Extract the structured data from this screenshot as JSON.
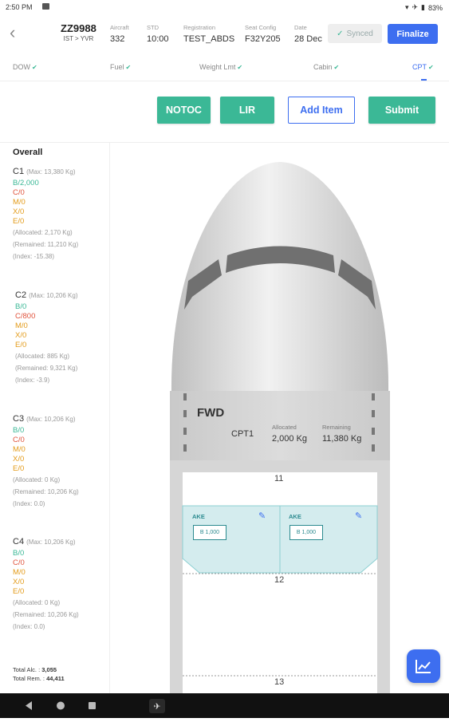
{
  "status": {
    "time": "2:50 PM",
    "battery": "83%"
  },
  "header": {
    "flight_no": "ZZ9988",
    "route": "IST > YVR",
    "columns": [
      {
        "label": "Aircraft",
        "value": "332"
      },
      {
        "label": "STD",
        "value": "10:00"
      },
      {
        "label": "Registration",
        "value": "TEST_ABDS"
      },
      {
        "label": "Seat Config",
        "value": "F32Y205"
      },
      {
        "label": "Date",
        "value": "28 Dec"
      }
    ],
    "synced_label": "Synced",
    "finalize_label": "Finalize"
  },
  "tabs": [
    {
      "label": "DOW"
    },
    {
      "label": "Fuel"
    },
    {
      "label": "Weight Lmt"
    },
    {
      "label": "Cabin"
    },
    {
      "label": "CPT"
    }
  ],
  "actions": {
    "notoc": "NOTOC",
    "lir": "LIR",
    "add_item": "Add Item",
    "submit": "Submit"
  },
  "sidebar": {
    "title": "Overall",
    "compartments": [
      {
        "name": "C1",
        "max": "(Max: 13,380 Kg)",
        "lines": [
          "B/2,000",
          "C/0",
          "M/0",
          "X/0",
          "E/0"
        ],
        "allocated": "(Allocated:    2,170 Kg)",
        "remained": "(Remained:  11,210 Kg)",
        "index": "(Index:    -15.38)"
      },
      {
        "name": "C2",
        "max": "(Max: 10,206 Kg)",
        "lines": [
          "B/0",
          "C/800",
          "M/0",
          "X/0",
          "E/0"
        ],
        "allocated": "(Allocated:     885 Kg)",
        "remained": "(Remained:  9,321 Kg)",
        "index": "(Index:    -3.9)"
      },
      {
        "name": "C3",
        "max": "(Max: 10,206 Kg)",
        "lines": [
          "B/0",
          "C/0",
          "M/0",
          "X/0",
          "E/0"
        ],
        "allocated": "(Allocated:     0 Kg)",
        "remained": "(Remained:  10,206 Kg)",
        "index": "(Index:    0.0)"
      },
      {
        "name": "C4",
        "max": "(Max: 10,206 Kg)",
        "lines": [
          "B/0",
          "C/0",
          "M/0",
          "X/0",
          "E/0"
        ],
        "allocated": "(Allocated:     0 Kg)",
        "remained": "(Remained:  10,206 Kg)",
        "index": "(Index:    0.0)"
      }
    ],
    "total_alc_label": "Total Alc. :",
    "total_alc": "3,055",
    "total_rem_label": "Total Rem. :",
    "total_rem": "44,411"
  },
  "plane": {
    "section": "FWD",
    "cpt": "CPT1",
    "allocated_label": "Allocated",
    "allocated": "2,000 Kg",
    "remaining_label": "Remaining",
    "remaining": "11,380 Kg",
    "positions": [
      "11",
      "12",
      "13"
    ],
    "ulds": [
      {
        "type": "AKE",
        "tag": "B 1,000"
      },
      {
        "type": "AKE",
        "tag": "B 1,000"
      }
    ]
  }
}
